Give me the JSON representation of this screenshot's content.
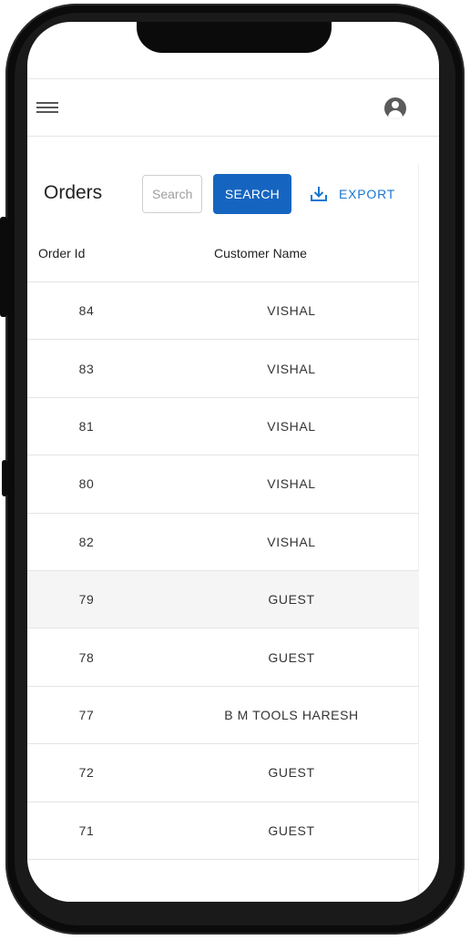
{
  "orders": {
    "title": "Orders",
    "search_placeholder": "Search",
    "search_label": "SEARCH",
    "export_label": "EXPORT"
  },
  "icons": {
    "menu": "menu-icon",
    "account": "account-circle-icon",
    "export": "download-icon"
  },
  "colors": {
    "primary_button": "#1565c0",
    "export_text": "#1976d2",
    "highlight_row": "#f5f5f5"
  },
  "table": {
    "columns": [
      "Order Id",
      "Customer Name"
    ],
    "rows": [
      {
        "id": "84",
        "customer": "VISHAL"
      },
      {
        "id": "83",
        "customer": "VISHAL"
      },
      {
        "id": "81",
        "customer": "VISHAL"
      },
      {
        "id": "80",
        "customer": "VISHAL"
      },
      {
        "id": "82",
        "customer": "VISHAL"
      },
      {
        "id": "79",
        "customer": "GUEST"
      },
      {
        "id": "78",
        "customer": "GUEST"
      },
      {
        "id": "77",
        "customer": "B M TOOLS HARESH"
      },
      {
        "id": "72",
        "customer": "GUEST"
      },
      {
        "id": "71",
        "customer": "GUEST"
      }
    ]
  }
}
